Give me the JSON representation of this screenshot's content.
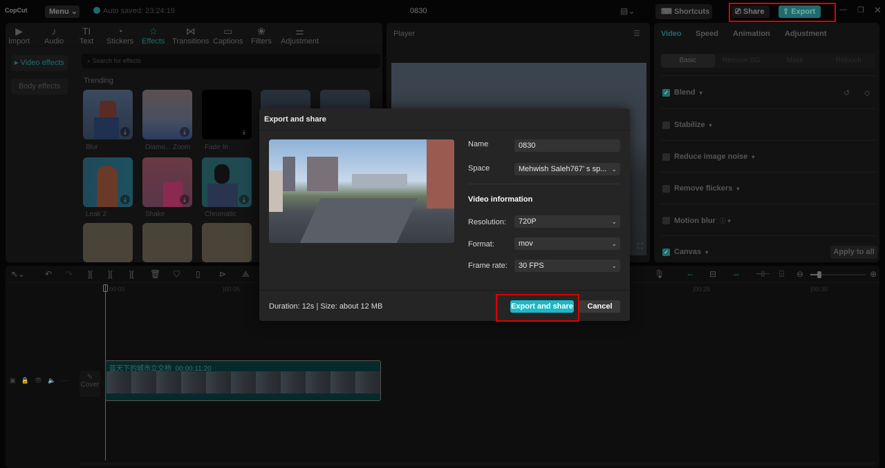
{
  "app": {
    "logo": "CopCut",
    "menu": "Menu",
    "autosave": "Auto saved: 23:24:19",
    "title": "0830",
    "shortcuts": "Shortcuts",
    "share": "Share",
    "export": "Export"
  },
  "media_tabs": [
    {
      "label": "Import",
      "icon": "▶"
    },
    {
      "label": "Audio",
      "icon": "♪"
    },
    {
      "label": "Text",
      "icon": "TI"
    },
    {
      "label": "Stickers",
      "icon": "◔"
    },
    {
      "label": "Effects",
      "icon": "☆"
    },
    {
      "label": "Transitions",
      "icon": "⋈"
    },
    {
      "label": "Captions",
      "icon": "▭"
    },
    {
      "label": "Filters",
      "icon": "❀"
    },
    {
      "label": "Adjustment",
      "icon": "⚌"
    }
  ],
  "effects": {
    "nav": [
      "Video effects",
      "Body effects"
    ],
    "search_placeholder": "Search for effects",
    "section": "Trending",
    "items": [
      "Blur",
      "Diamo... Zoom",
      "Fade In",
      "Leak 2",
      "Shake",
      "Chromatic"
    ]
  },
  "player": {
    "title": "Player"
  },
  "inspector": {
    "tabs": [
      "Video",
      "Speed",
      "Animation",
      "Adjustment"
    ],
    "subtabs": [
      "Basic",
      "Remove BG",
      "Mask",
      "Retouch"
    ],
    "rows": [
      {
        "label": "Blend",
        "checked": true
      },
      {
        "label": "Stabilize",
        "checked": false
      },
      {
        "label": "Reduce image noise",
        "checked": false
      },
      {
        "label": "Remove flickers",
        "checked": false
      },
      {
        "label": "Motion blur",
        "checked": false
      },
      {
        "label": "Canvas",
        "checked": true
      }
    ],
    "apply_all": "Apply to all"
  },
  "timeline": {
    "ticks": [
      "00:00",
      "00:05",
      "00:25",
      "00:30"
    ],
    "clip_title": "蓝天下的城市立交桥",
    "clip_duration": "00:00:11:20",
    "cover": "Cover"
  },
  "dialog": {
    "title": "Export and share",
    "name_label": "Name",
    "name_value": "0830",
    "space_label": "Space",
    "space_value": "Mehwish Saleh767’ s sp...",
    "video_info": "Video information",
    "resolution_label": "Resolution:",
    "resolution": "720P",
    "format_label": "Format:",
    "format": "mov",
    "framerate_label": "Frame rate:",
    "framerate": "30 FPS",
    "summary": "Duration: 12s | Size: about 12 MB",
    "export_button": "Export and share",
    "cancel_button": "Cancel"
  },
  "colors": {
    "accent": "#1bb8c8",
    "teal_dim": "#1f6c6d",
    "highlight": "#e00000"
  }
}
